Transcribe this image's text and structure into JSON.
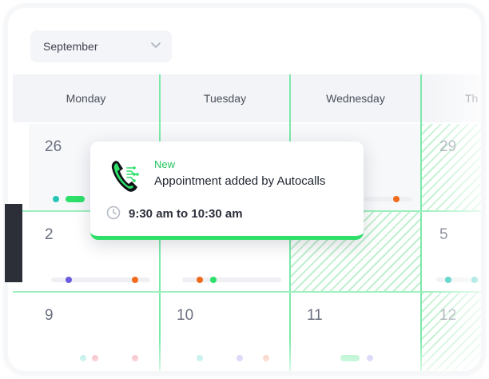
{
  "month_select": {
    "value": "September"
  },
  "weekdays": [
    "Monday",
    "Tuesday",
    "Wednesday",
    "Th"
  ],
  "days": {
    "row1": [
      "26",
      "29"
    ],
    "row2": [
      "2",
      "5"
    ],
    "row3": [
      "9",
      "10",
      "11",
      "12"
    ]
  },
  "popup": {
    "tag": "New",
    "title": "Appointment added by Autocalls",
    "time": "9:30 am to 10:30 am"
  },
  "icons": {
    "month_chevron": "chevron-down-icon",
    "phone": "phone-icon",
    "clock": "clock-icon"
  },
  "colors": {
    "accent": "#22c55e",
    "dot_teal": "#26c6b5",
    "dot_green": "#2ee06a",
    "dot_orange": "#f26b1d",
    "dot_purple": "#6a5ae0",
    "dot_pink": "#f08a9a",
    "dot_lavender": "#a8a6f0"
  }
}
